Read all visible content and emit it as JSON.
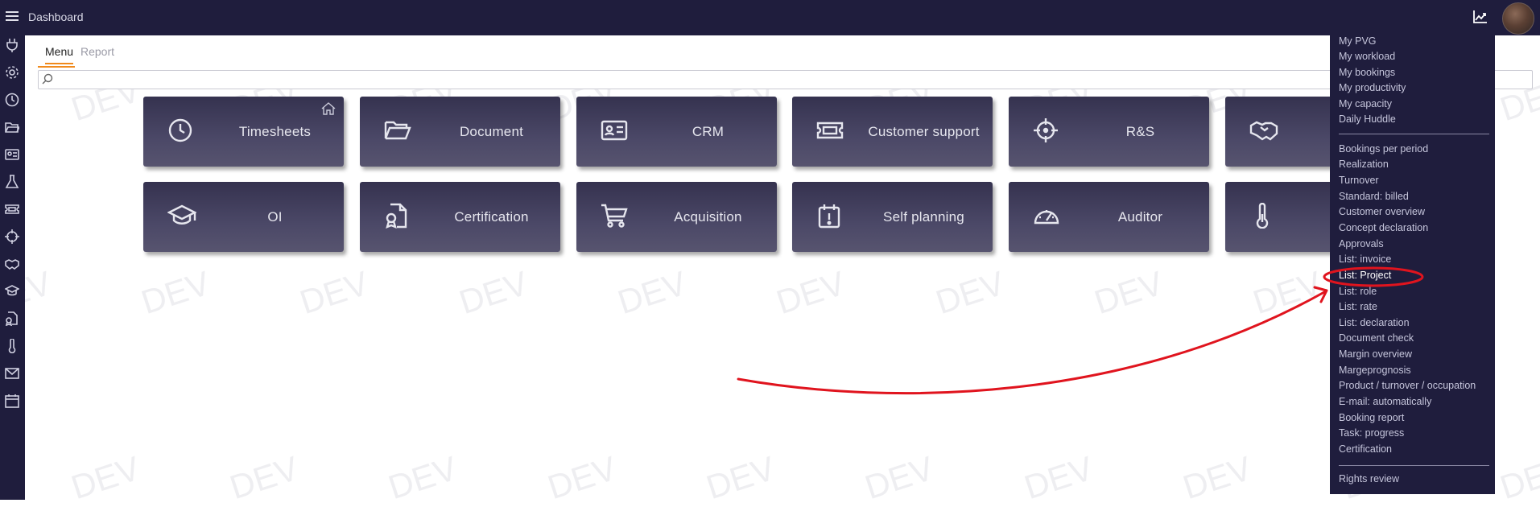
{
  "topbar": {
    "title": "Dashboard"
  },
  "tabs": [
    {
      "label": "Menu"
    },
    {
      "label": "Report"
    }
  ],
  "search": {
    "value": "",
    "placeholder": ""
  },
  "sidebar_icons": [
    "plug-icon",
    "gear-icon",
    "clock-icon",
    "folder-icon",
    "id-card-icon",
    "flask-icon",
    "ticket-icon",
    "crosshair-icon",
    "handshake-icon",
    "graduation-cap-icon",
    "certificate-icon",
    "thermometer-icon",
    "envelope-icon",
    "calendar-icon"
  ],
  "tiles": [
    {
      "label": "Timesheets",
      "icon": "clock-icon"
    },
    {
      "label": "Document",
      "icon": "folder-open-icon"
    },
    {
      "label": "CRM",
      "icon": "id-card-icon"
    },
    {
      "label": "Customer support",
      "icon": "ticket-icon"
    },
    {
      "label": "R&S",
      "icon": "crosshair-icon"
    },
    {
      "label": "",
      "icon": "handshake-icon"
    },
    {
      "label": "OI",
      "icon": "graduation-cap-icon"
    },
    {
      "label": "Certification",
      "icon": "certificate-icon"
    },
    {
      "label": "Acquisition",
      "icon": "cart-icon"
    },
    {
      "label": "Self planning",
      "icon": "calendar-alert-icon"
    },
    {
      "label": "Auditor",
      "icon": "gauge-icon"
    },
    {
      "label": "",
      "icon": "thermometer-icon"
    }
  ],
  "menu": {
    "group1": [
      "My PVG",
      "My workload",
      "My bookings",
      "My productivity",
      "My capacity",
      "Daily Huddle"
    ],
    "group2": [
      "Bookings per period",
      "Realization",
      "Turnover",
      "Standard: billed",
      "Customer overview",
      "Concept declaration",
      "Approvals",
      "List: invoice",
      "List: Project",
      "List: role",
      "List: rate",
      "List: declaration",
      "Document check",
      "Margin overview",
      "Margeprognosis",
      "Product / turnover / occupation",
      "E-mail: automatically",
      "Booking report",
      "Task: progress",
      "Certification"
    ],
    "group3": [
      "Rights review"
    ],
    "highlighted": "List: Project"
  },
  "watermark": "DEV",
  "colors": {
    "bar": "#1f1d3d",
    "tab_accent": "#f08a1c",
    "annotation": "#e0141e"
  }
}
